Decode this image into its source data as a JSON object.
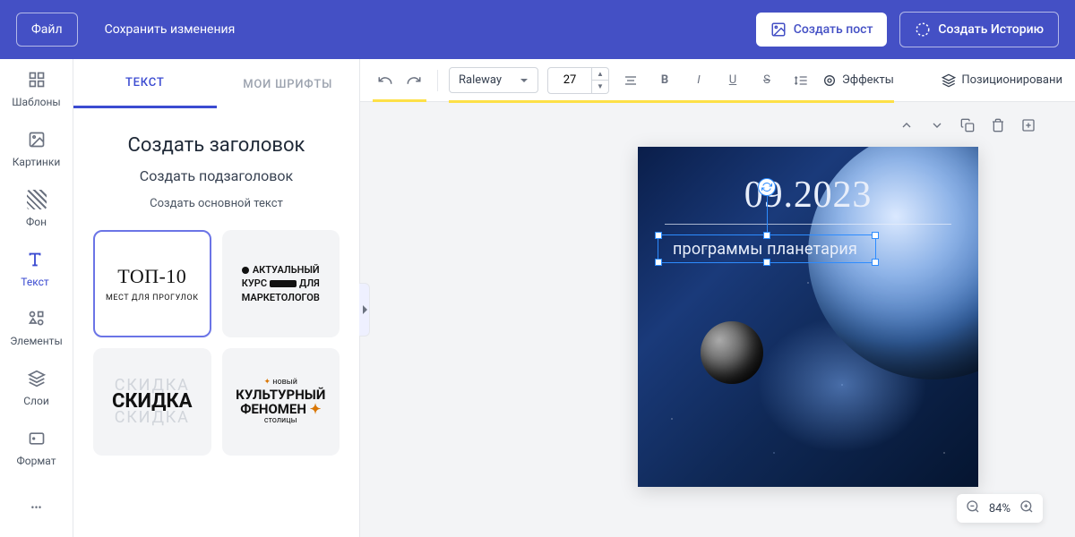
{
  "topbar": {
    "file": "Файл",
    "save": "Сохранить изменения",
    "create_post": "Создать пост",
    "create_story": "Создать Историю"
  },
  "rail": {
    "templates": "Шаблоны",
    "images": "Картинки",
    "background": "Фон",
    "text": "Текст",
    "elements": "Элементы",
    "layers": "Слои",
    "format": "Формат"
  },
  "panel": {
    "tab_text": "ТЕКСТ",
    "tab_fonts": "МОИ ШРИФТЫ",
    "add_heading": "Создать заголовок",
    "add_subheading": "Создать подзаголовок",
    "add_body": "Создать основной текст",
    "cards": {
      "top10": "ТОП-10",
      "top10_sub": "МЕСТ ДЛЯ ПРОГУЛОК",
      "akt_l1": "АКТУАЛЬНЫЙ",
      "akt_l2a": "КУРС",
      "akt_l2b": "ДЛЯ",
      "akt_l3": "МАРКЕТОЛОГОВ",
      "skidka": "СКИДКА",
      "kult_top": "новый",
      "kult_l1": "КУЛЬТУРНЫЙ",
      "kult_l2": "ФЕНОМЕН",
      "kult_bot": "столицы"
    }
  },
  "toolbar": {
    "font": "Raleway",
    "size": "27",
    "effects": "Эффекты",
    "positioning": "Позиционировани"
  },
  "canvas": {
    "date": "09.2023",
    "subtitle": "программы планетария",
    "zoom": "84%"
  }
}
